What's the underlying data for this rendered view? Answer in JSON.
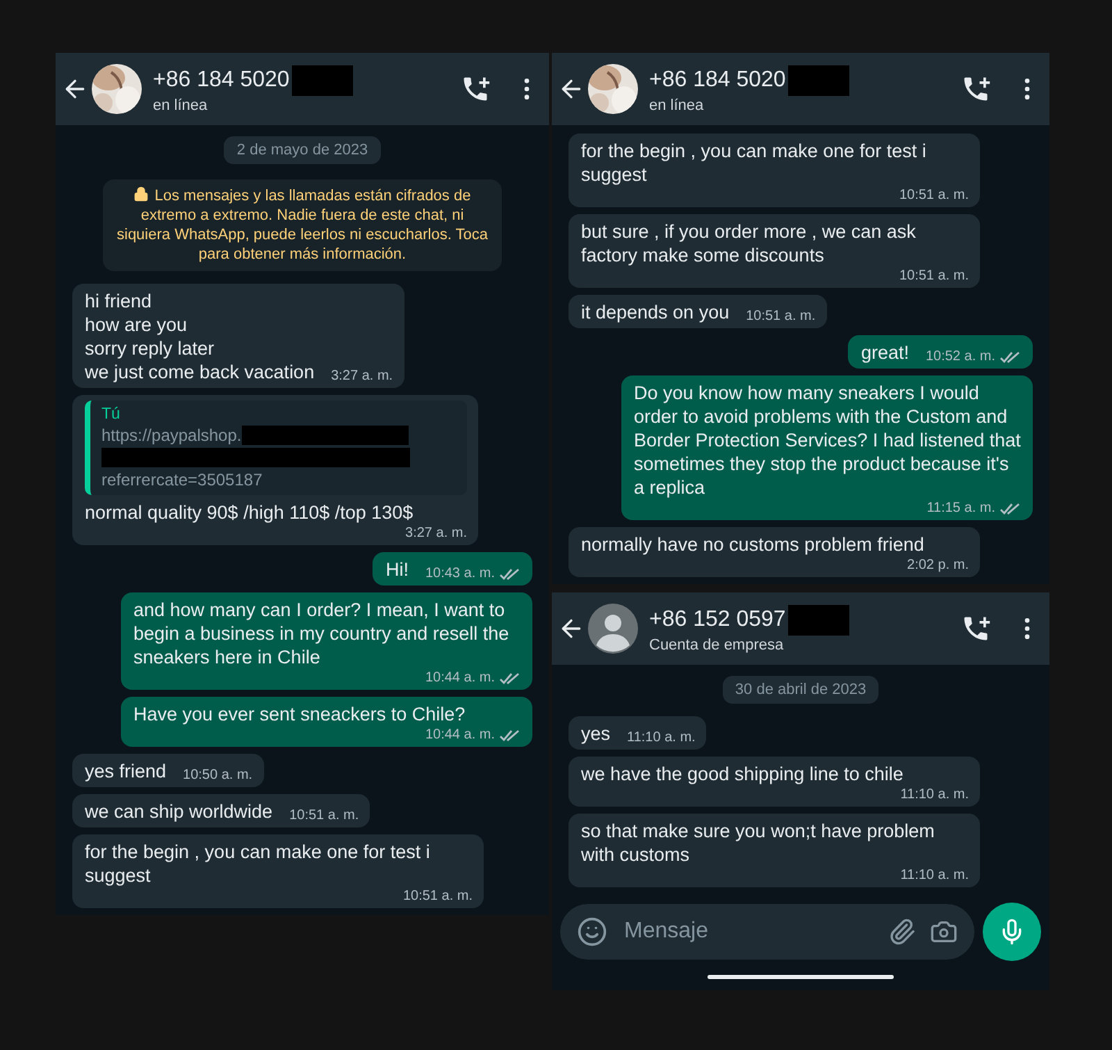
{
  "panels": [
    {
      "header": {
        "name": "+86 184 5020",
        "status": "en línea"
      },
      "messages": [
        {
          "kind": "date",
          "text": "2 de mayo de 2023"
        },
        {
          "kind": "notice",
          "text": "Los mensajes y las llamadas están cifrados de extremo a extremo. Nadie fuera de este chat, ni siquiera WhatsApp, puede leerlos ni escucharlos. Toca para obtener más información."
        },
        {
          "kind": "in",
          "text": "hi friend\nhow are you\nsorry reply later\nwe just come back vacation",
          "time": "3:27 a. m."
        },
        {
          "kind": "quote",
          "author": "Tú",
          "url_start": "https://paypalshop.",
          "url_end": "referrercate=3505187",
          "text": "normal quality 90$ /high 110$ /top 130$",
          "time": "3:27 a. m."
        },
        {
          "kind": "out",
          "text": "Hi!",
          "time": "10:43 a. m."
        },
        {
          "kind": "out",
          "text": "and how many can I order? I mean, I want to begin a business in my country and resell the sneakers here in Chile",
          "time": "10:44 a. m."
        },
        {
          "kind": "out",
          "text": "Have you ever sent sneackers to Chile?",
          "time": "10:44 a. m."
        },
        {
          "kind": "in",
          "text": "yes friend",
          "time": "10:50 a. m."
        },
        {
          "kind": "in",
          "text": "we can ship worldwide",
          "time": "10:51 a. m."
        },
        {
          "kind": "in",
          "text": "for the begin , you can make one for test i suggest",
          "time": "10:51 a. m."
        }
      ]
    },
    {
      "header": {
        "name": "+86 184 5020",
        "status": "en línea"
      },
      "messages": [
        {
          "kind": "in",
          "text": "for the begin , you can make one for test i suggest",
          "time": "10:51 a. m."
        },
        {
          "kind": "in",
          "text": "but sure , if you order more , we can ask factory make some discounts",
          "time": "10:51 a. m."
        },
        {
          "kind": "in",
          "text": "it depends on you",
          "time": "10:51 a. m."
        },
        {
          "kind": "out",
          "text": "great!",
          "time": "10:52 a. m."
        },
        {
          "kind": "out",
          "text": "Do you know how many sneakers I would order to avoid problems with the Custom and Border Protection Services? I had listened that sometimes they stop the product because it's a replica",
          "time": "11:15 a. m."
        },
        {
          "kind": "in",
          "text": "normally have no customs problem friend",
          "time": "2:02 p. m."
        }
      ]
    },
    {
      "header": {
        "name": "+86 152 0597",
        "status": "Cuenta de empresa",
        "avatar": {
          "kind": "silhouette"
        }
      },
      "messages": [
        {
          "kind": "date",
          "text": "30 de abril de 2023"
        },
        {
          "kind": "in",
          "text": "yes",
          "time": "11:10 a. m."
        },
        {
          "kind": "in",
          "text": "we have the good shipping line to chile",
          "time": "11:10 a. m."
        },
        {
          "kind": "in",
          "text": "so that make sure you won;t have problem with customs",
          "time": "11:10 a. m."
        }
      ],
      "composer": {
        "placeholder": "Mensaje"
      }
    }
  ]
}
